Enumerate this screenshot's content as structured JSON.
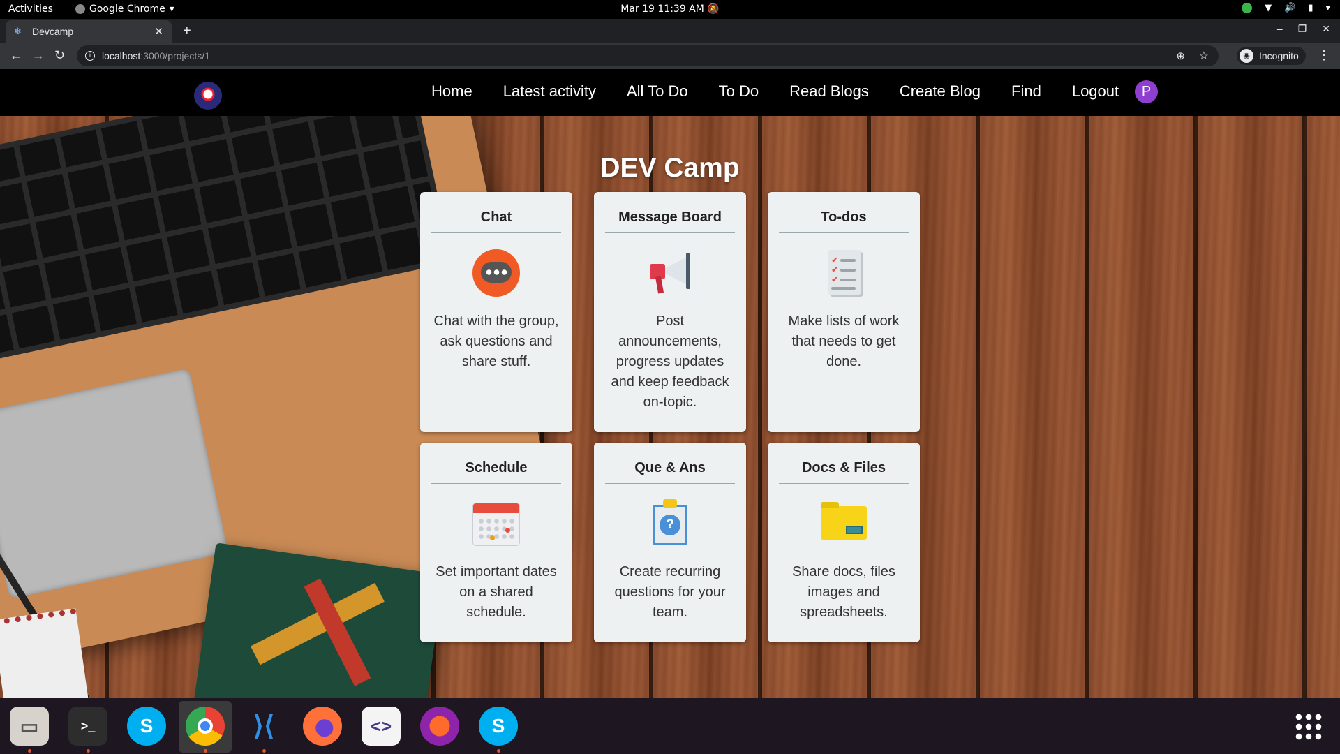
{
  "gnome": {
    "activities": "Activities",
    "app_name": "Google Chrome",
    "clock": "Mar 19  11:39 AM"
  },
  "browser": {
    "tab_title": "Devcamp",
    "url_host": "localhost",
    "url_path": ":3000/projects/1",
    "profile_label": "Incognito"
  },
  "nav": {
    "items": [
      {
        "label": "Home"
      },
      {
        "label": "Latest activity"
      },
      {
        "label": "All To Do"
      },
      {
        "label": "To Do"
      },
      {
        "label": "Read Blogs"
      },
      {
        "label": "Create Blog"
      },
      {
        "label": "Find"
      },
      {
        "label": "Logout"
      }
    ],
    "avatar_letter": "P"
  },
  "page": {
    "title": "DEV Camp"
  },
  "cards": [
    {
      "title": "Chat",
      "icon": "chat-icon",
      "description": "Chat with the group, ask questions and share stuff."
    },
    {
      "title": "Message Board",
      "icon": "megaphone-icon",
      "description": "Post announcements, progress updates and keep feedback on-topic."
    },
    {
      "title": "To-dos",
      "icon": "checklist-icon",
      "description": "Make lists of work that needs to get done."
    },
    {
      "title": "Schedule",
      "icon": "calendar-icon",
      "description": "Set important dates on a shared schedule."
    },
    {
      "title": "Que & Ans",
      "icon": "question-clipboard-icon",
      "description": "Create recurring questions for your team."
    },
    {
      "title": "Docs & Files",
      "icon": "folder-icon",
      "description": "Share docs, files images and spreadsheets."
    }
  ],
  "colors": {
    "accent_avatar": "#8e3fcf",
    "navbar_bg": "#000000",
    "card_bg": "#eef1f2"
  }
}
